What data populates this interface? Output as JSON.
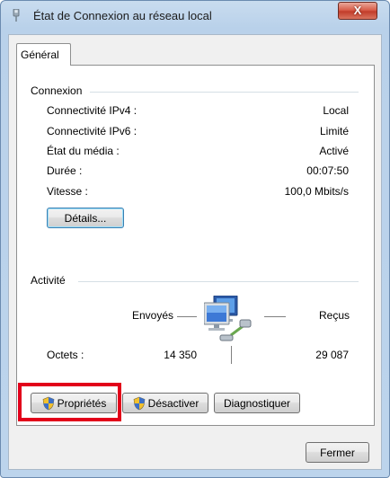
{
  "window": {
    "title": "État de Connexion au réseau local",
    "close_glyph": "X"
  },
  "tabs": [
    {
      "label": "Général"
    }
  ],
  "connection": {
    "group_title": "Connexion",
    "rows": [
      {
        "label": "Connectivité IPv4 :",
        "value": "Local"
      },
      {
        "label": "Connectivité IPv6 :",
        "value": "Limité"
      },
      {
        "label": "État du média :",
        "value": "Activé"
      },
      {
        "label": "Durée :",
        "value": "00:07:50"
      },
      {
        "label": "Vitesse :",
        "value": "100,0 Mbits/s"
      }
    ],
    "details_button": "Détails..."
  },
  "activity": {
    "group_title": "Activité",
    "sent_label": "Envoyés",
    "received_label": "Reçus",
    "bytes_label": "Octets :",
    "bytes_sent": "14 350",
    "bytes_received": "29 087"
  },
  "actions": {
    "properties": "Propriétés",
    "disable": "Désactiver",
    "diagnose": "Diagnostiquer"
  },
  "footer": {
    "close": "Fermer"
  },
  "icons": {
    "title": "network-connection-icon",
    "activity": "network-computer-icon",
    "shield": "uac-shield-icon"
  },
  "colors": {
    "highlight": "#e2001a",
    "titlebar": "#c9dcef",
    "close_button": "#c94a37"
  }
}
